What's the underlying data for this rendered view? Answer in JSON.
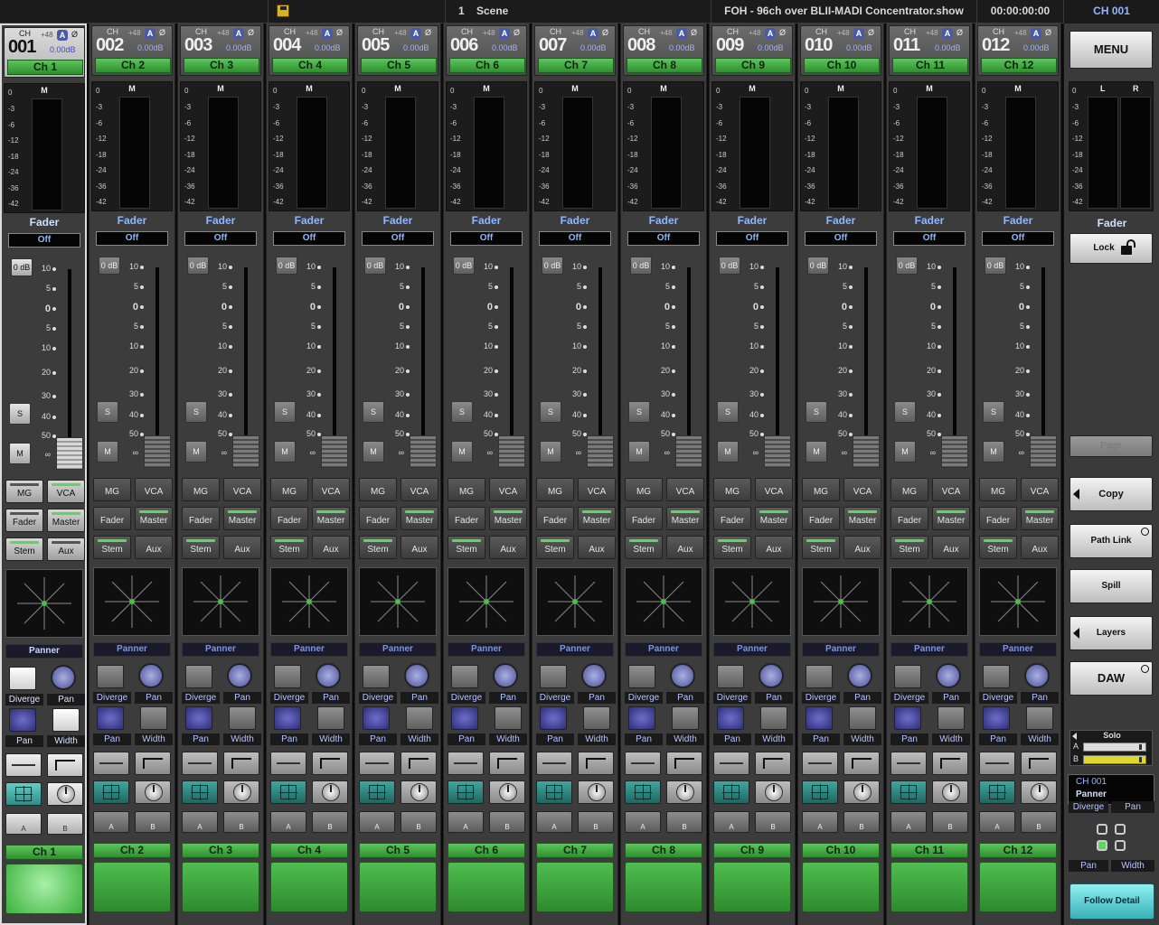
{
  "topbar": {
    "save_icon": "save-disk-icon",
    "scene_number": "1",
    "scene_label": "Scene",
    "show_name": "FOH - 96ch over BLII-MADI Concentrator.show",
    "timecode": "00:00:00:00",
    "current_channel": "CH 001"
  },
  "strip_common": {
    "ch_label": "CH",
    "phantom": "+48",
    "auto_badge": "A",
    "phase": "Ø",
    "gain": "0.00dB",
    "meter_title": "M",
    "meter_scale": [
      "0",
      "-3",
      "-6",
      "-12",
      "-18",
      "-24",
      "-36",
      "-42"
    ],
    "fader_title": "Fader",
    "fader_mode": "Off",
    "zero_db_btn": "0 dB",
    "fader_scale": [
      "10",
      "5",
      "0",
      "5",
      "10",
      "20",
      "30",
      "40",
      "50",
      "∞"
    ],
    "solo_btn": "S",
    "mute_btn": "M",
    "assign_buttons": [
      "MG",
      "VCA",
      "Fader",
      "Master",
      "Stem",
      "Aux"
    ],
    "panner_title": "Panner",
    "diverge_label": "Diverge",
    "pan_label": "Pan",
    "pan2_label": "Pan",
    "width_label": "Width",
    "a_label": "A",
    "b_label": "B"
  },
  "channels": [
    {
      "num": "001",
      "name": "Ch 1"
    },
    {
      "num": "002",
      "name": "Ch 2"
    },
    {
      "num": "003",
      "name": "Ch 3"
    },
    {
      "num": "004",
      "name": "Ch 4"
    },
    {
      "num": "005",
      "name": "Ch 5"
    },
    {
      "num": "006",
      "name": "Ch 6"
    },
    {
      "num": "007",
      "name": "Ch 7"
    },
    {
      "num": "008",
      "name": "Ch 8"
    },
    {
      "num": "009",
      "name": "Ch 9"
    },
    {
      "num": "010",
      "name": "Ch 10"
    },
    {
      "num": "011",
      "name": "Ch 11"
    },
    {
      "num": "012",
      "name": "Ch 12"
    }
  ],
  "right_panel": {
    "menu": "MENU",
    "meter_left": "L",
    "meter_right": "R",
    "fader_title": "Fader",
    "lock": "Lock",
    "page": "Page",
    "copy": "Copy",
    "path_link": "Path Link",
    "spill": "Spill",
    "layers": "Layers",
    "daw": "DAW",
    "solo": "Solo",
    "solo_a": "A",
    "solo_b": "B",
    "info_ch": "CH 001",
    "info_mode": "Panner",
    "diverge": "Diverge",
    "pan": "Pan",
    "pan_bottom": "Pan",
    "width": "Width",
    "follow_detail": "Follow Detail"
  },
  "colors": {
    "accent_green": "#4cbf4c",
    "accent_blue": "#8fb7ff",
    "teal": "#60d0c8"
  }
}
